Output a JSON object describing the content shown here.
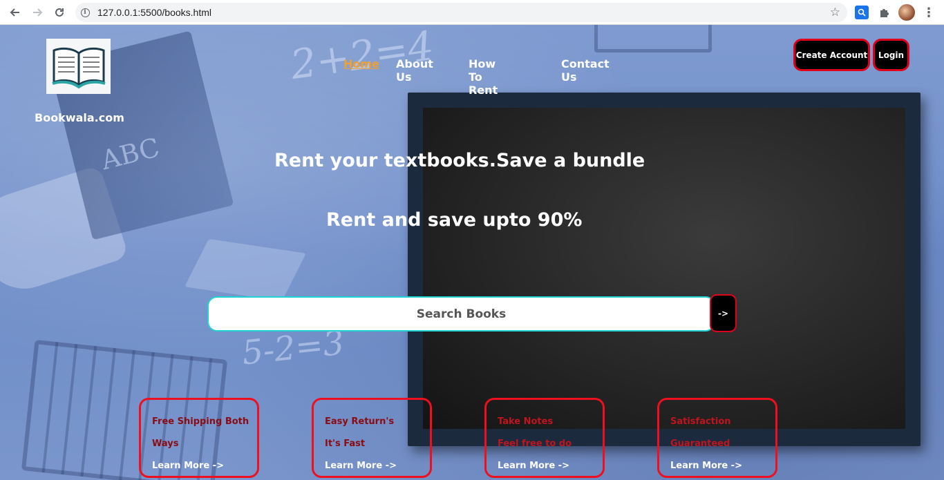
{
  "browser": {
    "url": "127.0.0.1:5500/books.html",
    "back_icon": "arrow-left",
    "forward_icon": "arrow-right",
    "reload_icon": "reload",
    "info_icon": "info",
    "bookmark_icon": "star",
    "extensions": [
      "search-extension-icon",
      "puzzle-icon",
      "profile-avatar",
      "more-vert-icon"
    ]
  },
  "site": {
    "brand": "Bookwala.com",
    "logo_icon": "open-book"
  },
  "nav": {
    "items": [
      {
        "label": "Home",
        "active": true
      },
      {
        "label": "About Us",
        "active": false
      },
      {
        "label": "How To Rent",
        "active": false
      },
      {
        "label": "Contact Us",
        "active": false
      }
    ],
    "active_color": "#f0a030"
  },
  "auth": {
    "create_account": "Create Account",
    "login": "Login"
  },
  "hero": {
    "headline": "Rent your textbooks.Save a bundle",
    "subheadline": "Rent and save upto 90%"
  },
  "search": {
    "placeholder": "Search Books",
    "button_label": "->"
  },
  "features": [
    {
      "line1": "Free Shipping Both",
      "line2": "Ways",
      "link": "Learn More ->"
    },
    {
      "line1": "Easy Return's",
      "line2": "It's Fast",
      "link": "Learn More ->"
    },
    {
      "line1": "Take Notes",
      "line2": "Feel free to do",
      "link": "Learn More ->"
    },
    {
      "line1": "Satisfaction",
      "line2": "Guaranteed",
      "link": "Learn More ->"
    }
  ],
  "colors": {
    "button_border": "#e0001a",
    "card_border": "#ee0f1f",
    "search_border": "#22d3d3"
  }
}
